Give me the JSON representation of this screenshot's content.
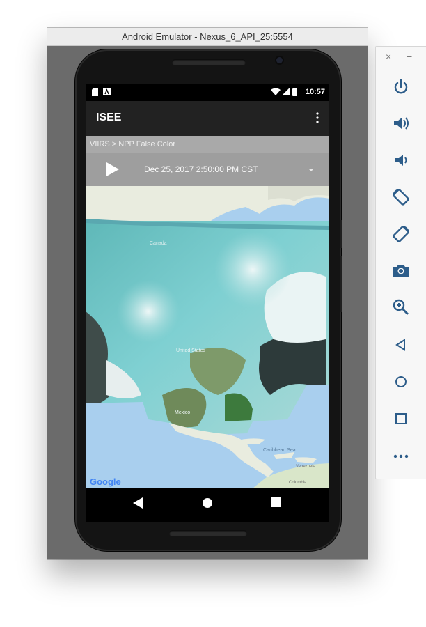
{
  "window": {
    "title": "Android Emulator - Nexus_6_API_25:5554"
  },
  "status_bar": {
    "time": "10:57"
  },
  "app_bar": {
    "title": "ISEE"
  },
  "breadcrumb": {
    "text": "VIIRS  >  NPP False Color"
  },
  "time_bar": {
    "datetime": "Dec 25, 2017 2:50:00 PM CST"
  },
  "map": {
    "labels": {
      "canada": "Canada",
      "united_states": "United States",
      "mexico": "Mexico",
      "caribbean_sea": "Caribbean Sea",
      "venezuela": "Venezuela",
      "colombia": "Colombia"
    },
    "attribution": "Google"
  },
  "emulator_toolbar": {
    "close": "×",
    "minimize": "−",
    "items": [
      "power-icon",
      "volume-up-icon",
      "volume-down-icon",
      "rotate-left-icon",
      "rotate-right-icon",
      "camera-icon",
      "zoom-icon",
      "back-icon",
      "home-icon",
      "overview-icon",
      "more-icon"
    ]
  },
  "colors": {
    "toolbar_icon": "#2d5d8a",
    "app_bar": "#222222",
    "breadcrumb": "#a9a9a9",
    "time_bar": "#9e9e9e",
    "ocean": "#a9cfee",
    "land": "#e9ecdf"
  }
}
